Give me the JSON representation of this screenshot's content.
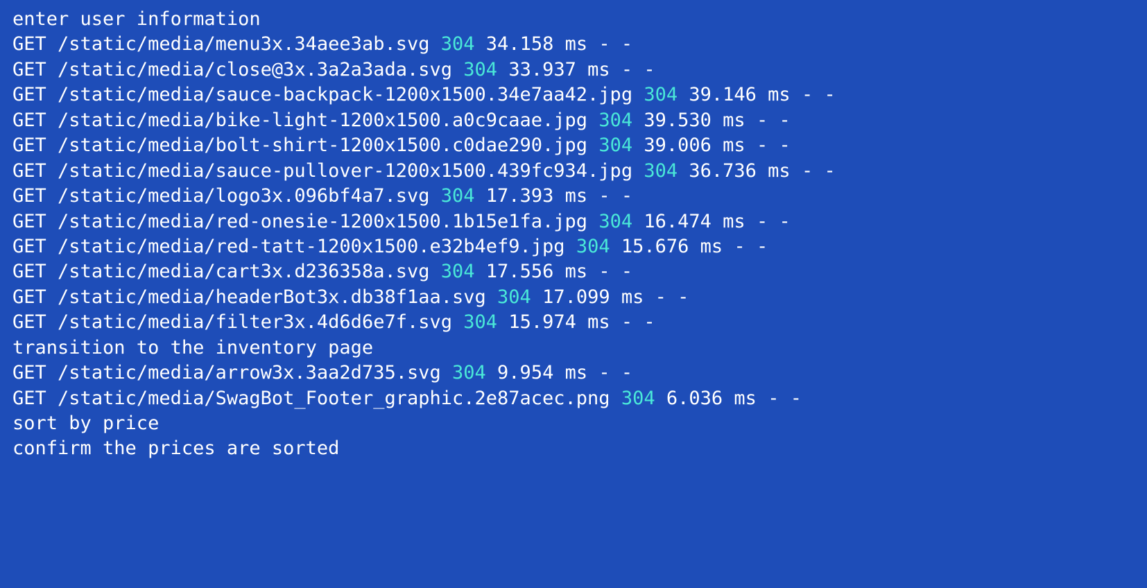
{
  "lines": [
    {
      "type": "plain",
      "text": "enter user information"
    },
    {
      "type": "request",
      "method": "GET",
      "path": "/static/media/menu3x.34aee3ab.svg",
      "status": "304",
      "timing": "34.158 ms",
      "suffix": "- -"
    },
    {
      "type": "request",
      "method": "GET",
      "path": "/static/media/close@3x.3a2a3ada.svg",
      "status": "304",
      "timing": "33.937 ms",
      "suffix": "- -"
    },
    {
      "type": "request",
      "method": "GET",
      "path": "/static/media/sauce-backpack-1200x1500.34e7aa42.jpg",
      "status": "304",
      "timing": "39.146 ms",
      "suffix": "- -"
    },
    {
      "type": "request",
      "method": "GET",
      "path": "/static/media/bike-light-1200x1500.a0c9caae.jpg",
      "status": "304",
      "timing": "39.530 ms",
      "suffix": "- -"
    },
    {
      "type": "request",
      "method": "GET",
      "path": "/static/media/bolt-shirt-1200x1500.c0dae290.jpg",
      "status": "304",
      "timing": "39.006 ms",
      "suffix": "- -"
    },
    {
      "type": "request",
      "method": "GET",
      "path": "/static/media/sauce-pullover-1200x1500.439fc934.jpg",
      "status": "304",
      "timing": "36.736 ms",
      "suffix": "- -"
    },
    {
      "type": "request",
      "method": "GET",
      "path": "/static/media/logo3x.096bf4a7.svg",
      "status": "304",
      "timing": "17.393 ms",
      "suffix": "- -"
    },
    {
      "type": "request",
      "method": "GET",
      "path": "/static/media/red-onesie-1200x1500.1b15e1fa.jpg",
      "status": "304",
      "timing": "16.474 ms",
      "suffix": "- -"
    },
    {
      "type": "request",
      "method": "GET",
      "path": "/static/media/red-tatt-1200x1500.e32b4ef9.jpg",
      "status": "304",
      "timing": "15.676 ms",
      "suffix": "- -"
    },
    {
      "type": "request",
      "method": "GET",
      "path": "/static/media/cart3x.d236358a.svg",
      "status": "304",
      "timing": "17.556 ms",
      "suffix": "- -"
    },
    {
      "type": "request",
      "method": "GET",
      "path": "/static/media/headerBot3x.db38f1aa.svg",
      "status": "304",
      "timing": "17.099 ms",
      "suffix": "- -"
    },
    {
      "type": "request",
      "method": "GET",
      "path": "/static/media/filter3x.4d6d6e7f.svg",
      "status": "304",
      "timing": "15.974 ms",
      "suffix": "- -"
    },
    {
      "type": "plain",
      "text": "transition to the inventory page"
    },
    {
      "type": "request",
      "method": "GET",
      "path": "/static/media/arrow3x.3aa2d735.svg",
      "status": "304",
      "timing": "9.954 ms",
      "suffix": "- -"
    },
    {
      "type": "request",
      "method": "GET",
      "path": "/static/media/SwagBot_Footer_graphic.2e87acec.png",
      "status": "304",
      "timing": "6.036 ms",
      "suffix": "- -"
    },
    {
      "type": "plain",
      "text": "sort by price"
    },
    {
      "type": "plain",
      "text": "confirm the prices are sorted"
    }
  ]
}
